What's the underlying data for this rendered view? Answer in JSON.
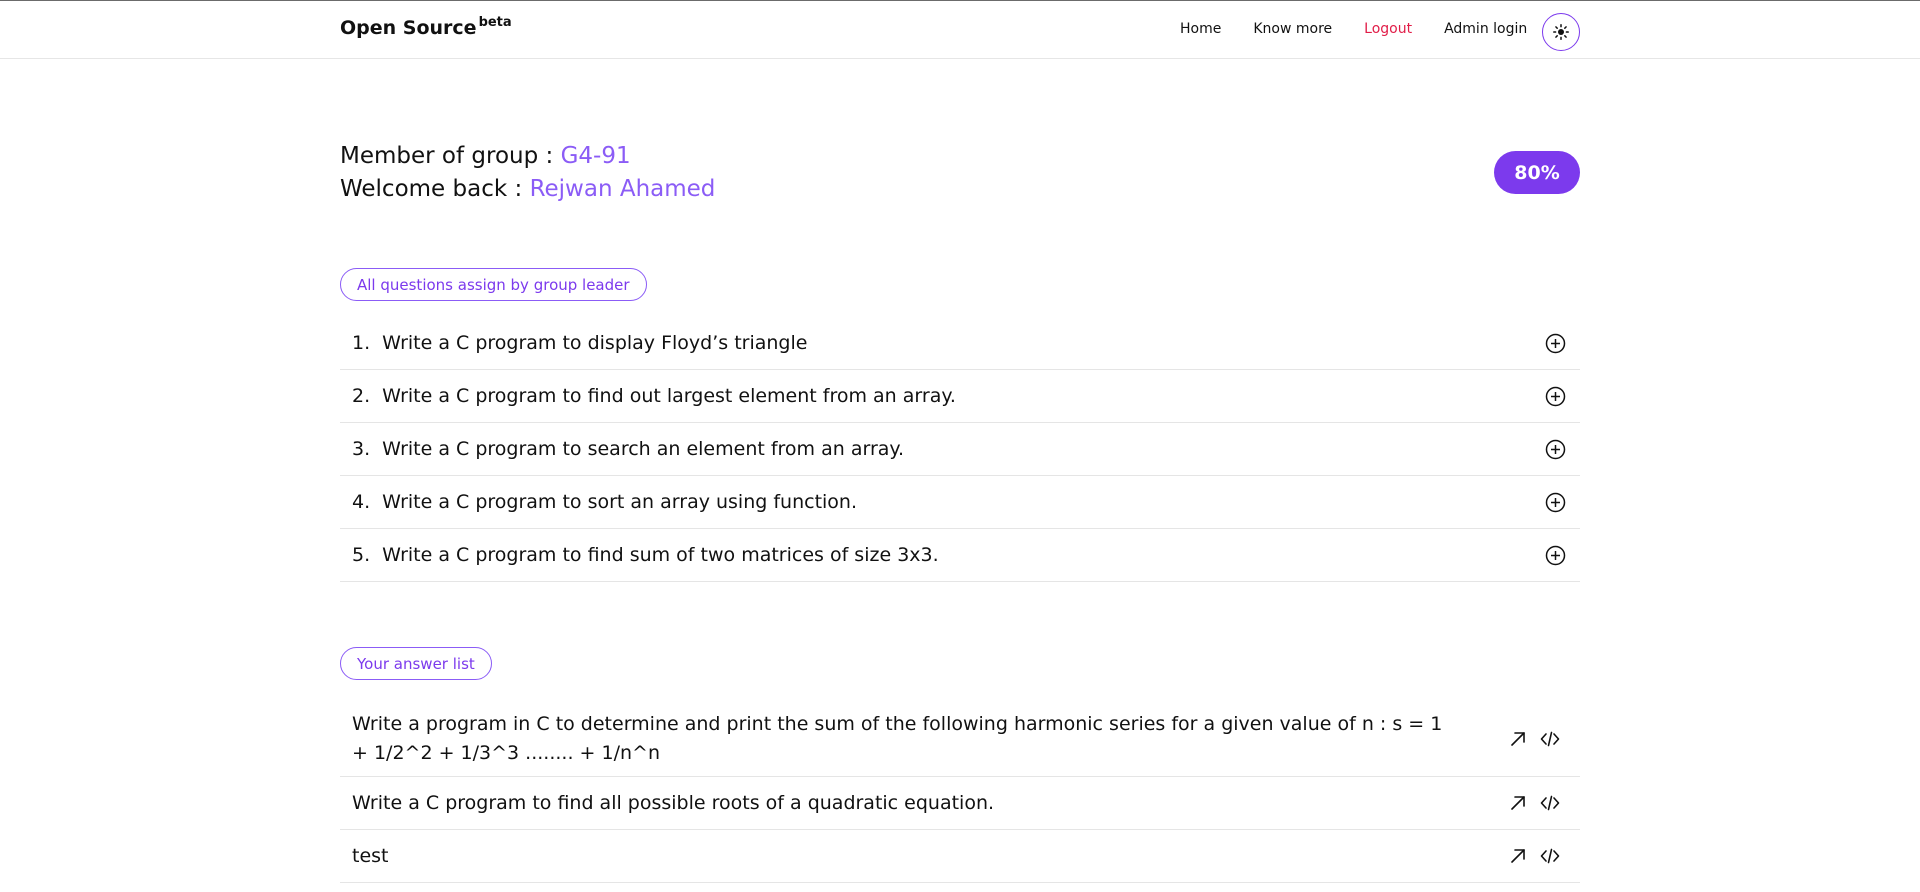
{
  "header": {
    "brand": "Open Source",
    "brand_badge": "beta",
    "nav": [
      "Home",
      "Know more",
      "Logout",
      "Admin login"
    ],
    "theme_icon": "sun-icon"
  },
  "welcome": {
    "group_label": "Member of group : ",
    "group_value": "G4-91",
    "welcome_label": "Welcome back : ",
    "user_name": "Rejwan Ahamed"
  },
  "progress": {
    "value": "80%"
  },
  "questions": {
    "pill_label": "All questions assign by group leader",
    "items": [
      {
        "num": "1.",
        "text": "Write a C program to display Floyd’s triangle"
      },
      {
        "num": "2.",
        "text": "Write a C program to find out largest element from an array."
      },
      {
        "num": "3.",
        "text": "Write a C program to search an element from an array."
      },
      {
        "num": "4.",
        "text": "Write a C program to sort an array using function."
      },
      {
        "num": "5.",
        "text": "Write a C program to find sum of two matrices of size 3x3."
      }
    ]
  },
  "answers": {
    "pill_label": "Your answer list",
    "items": [
      {
        "text": "Write a program in C to determine and print the sum of the following harmonic series for a given value of n : s = 1 + 1/2^2 + 1/3^3 ........ + 1/n^n"
      },
      {
        "text": "Write a C program to find all possible roots of a quadratic equation."
      },
      {
        "text": "test"
      }
    ]
  },
  "colors": {
    "accent": "#7c3aed",
    "accent_light": "#8b5cf6",
    "logout": "#e11d48"
  }
}
